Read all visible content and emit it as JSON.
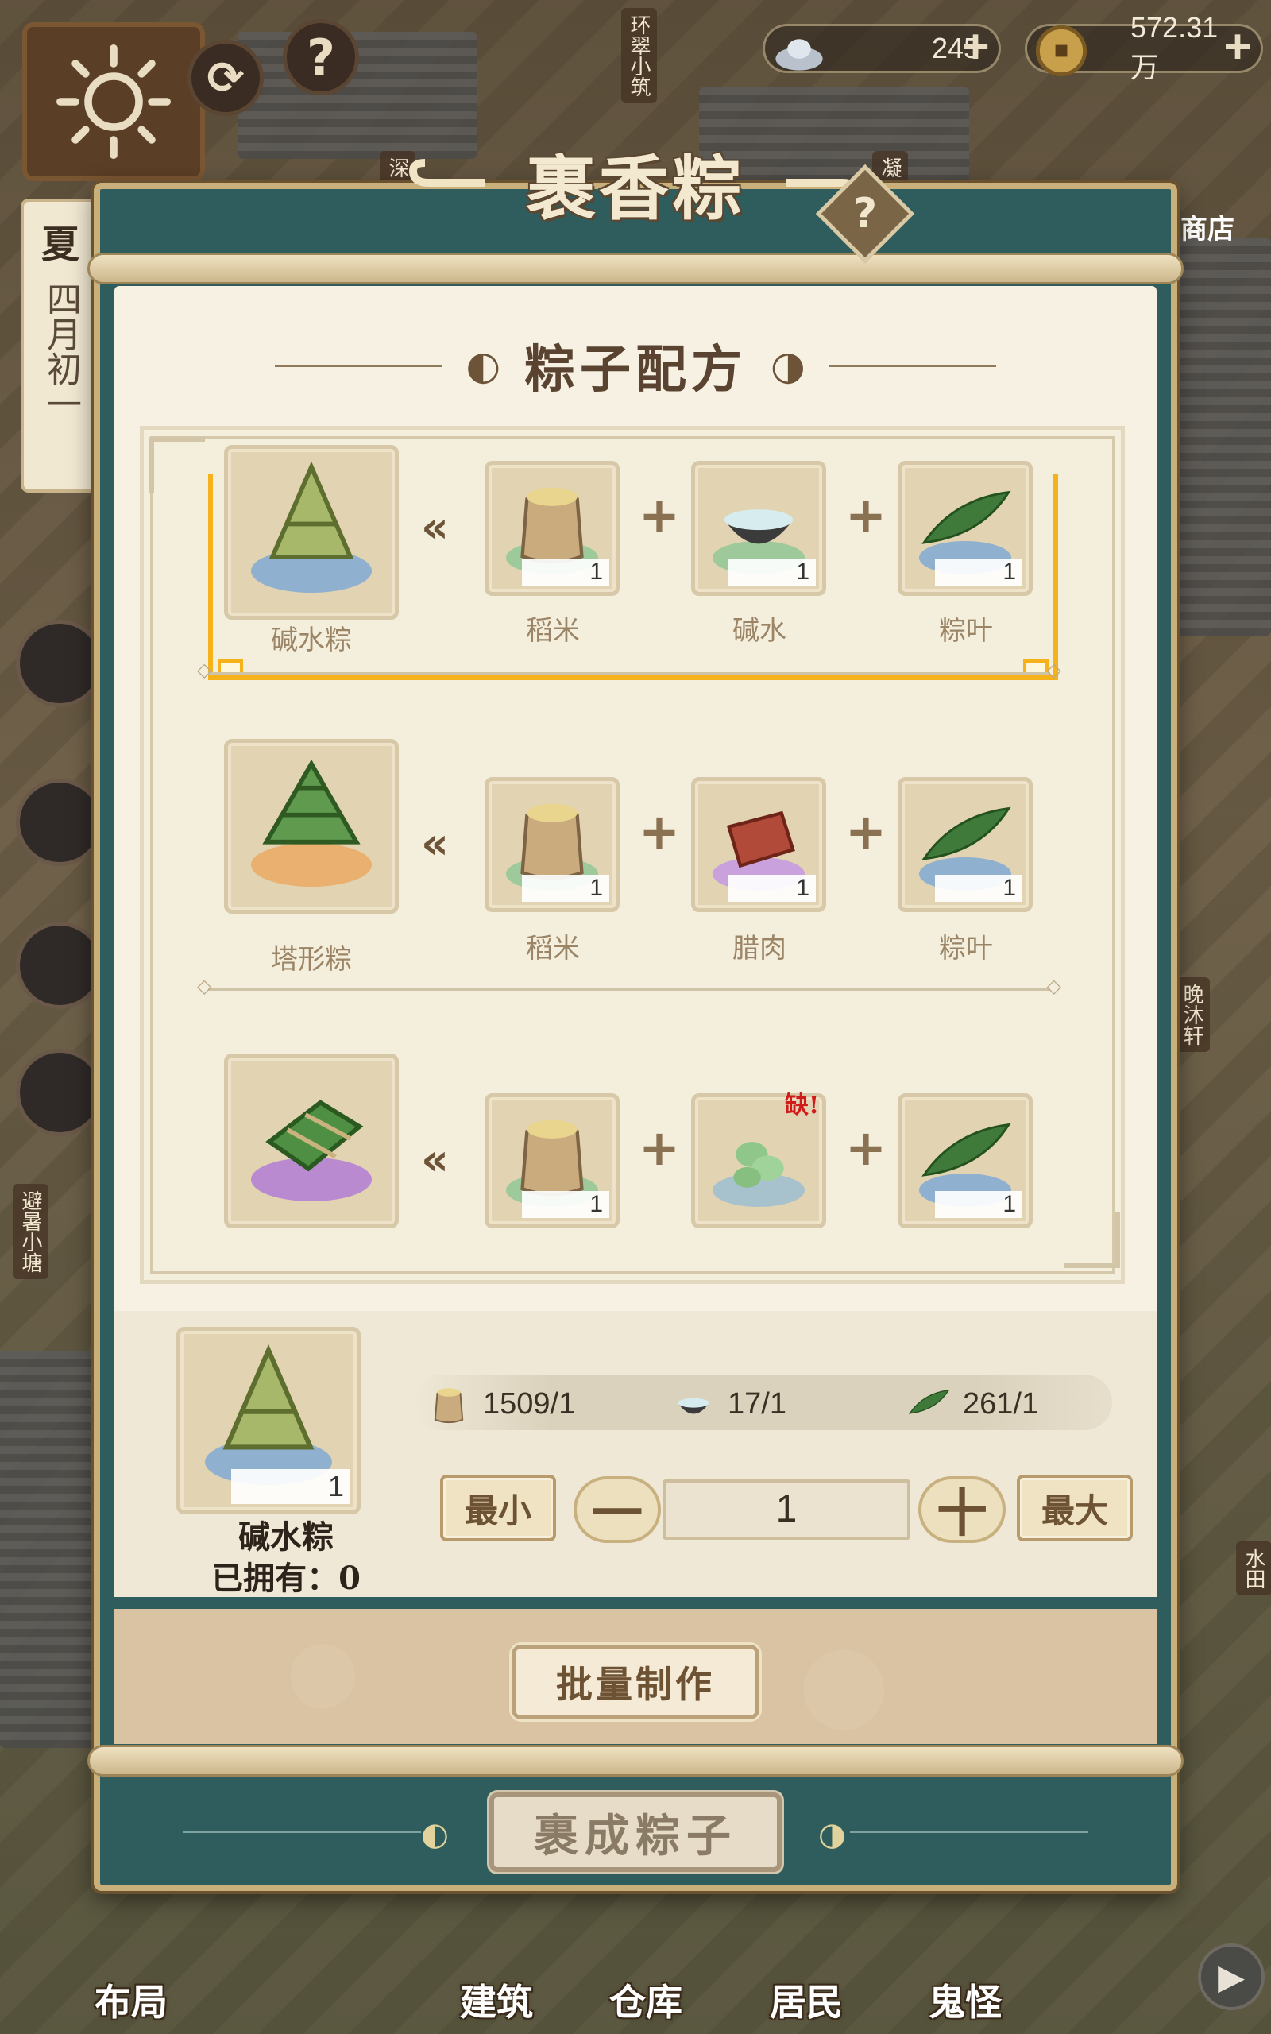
{
  "hud": {
    "currency_silver": "245",
    "currency_coins": "572.31万",
    "season": "夏",
    "date": "四月初一",
    "shop_label": "商店",
    "side_labels": [
      "环翠小筑",
      "深",
      "凝",
      "避暑小塘",
      "晚沐轩",
      "水田"
    ]
  },
  "dialog": {
    "title": "裹香粽",
    "section_title": "粽子配方",
    "recipes": [
      {
        "product": "碱水粽",
        "selected": true,
        "ingredients": [
          {
            "name": "稻米",
            "count": "1",
            "icon": "rice-sack-icon"
          },
          {
            "name": "碱水",
            "count": "1",
            "icon": "lye-water-bowl-icon"
          },
          {
            "name": "粽叶",
            "count": "1",
            "icon": "bamboo-leaf-icon"
          }
        ]
      },
      {
        "product": "塔形粽",
        "selected": false,
        "ingredients": [
          {
            "name": "稻米",
            "count": "1",
            "icon": "rice-sack-icon"
          },
          {
            "name": "腊肉",
            "count": "1",
            "icon": "cured-meat-icon"
          },
          {
            "name": "粽叶",
            "count": "1",
            "icon": "bamboo-leaf-icon"
          }
        ]
      },
      {
        "product": "",
        "selected": false,
        "ingredients": [
          {
            "name": "",
            "count": "1",
            "icon": "rice-sack-icon"
          },
          {
            "name": "",
            "count": "",
            "icon": "green-bean-icon",
            "missing_badge": "缺!"
          },
          {
            "name": "",
            "count": "1",
            "icon": "bamboo-leaf-icon"
          }
        ]
      }
    ],
    "craft": {
      "item_name": "碱水粽",
      "item_count": "1",
      "owned_label": "已拥有：",
      "owned_value": "0",
      "inventory": [
        {
          "icon": "rice-sack-icon",
          "text": "1509/1"
        },
        {
          "icon": "lye-water-bowl-icon",
          "text": "17/1"
        },
        {
          "icon": "bamboo-leaf-icon",
          "text": "261/1"
        }
      ],
      "min_label": "最小",
      "max_label": "最大",
      "minus_symbol": "一",
      "plus_symbol": "十",
      "quantity": "1",
      "batch_label": "批量制作"
    },
    "wrap_button": "裹成粽子"
  },
  "bottom_nav": [
    {
      "label": "布局"
    },
    {
      "label": "建筑"
    },
    {
      "label": "仓库"
    },
    {
      "label": "居民"
    },
    {
      "label": "鬼怪"
    }
  ]
}
